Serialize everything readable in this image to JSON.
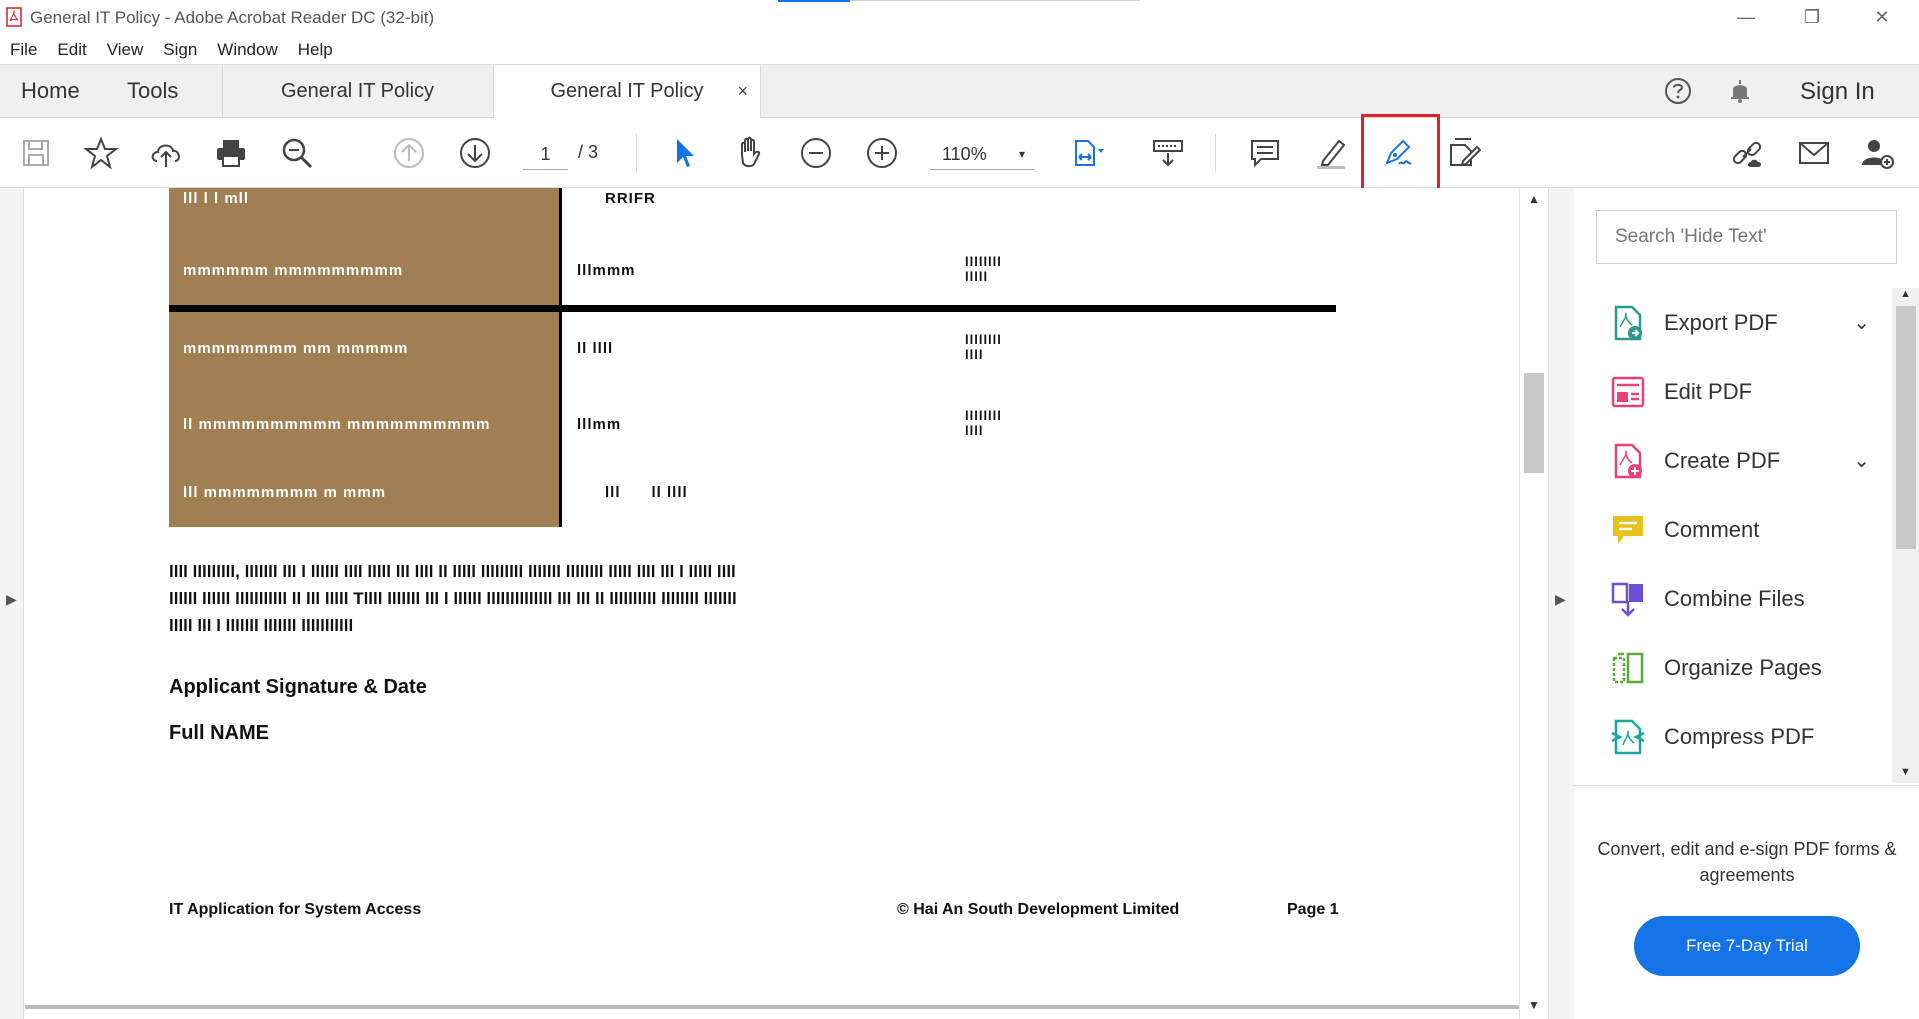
{
  "window": {
    "title": "General IT Policy - Adobe Acrobat Reader DC (32-bit)",
    "minimize": "—",
    "restore": "❐",
    "close": "✕"
  },
  "menu": [
    "File",
    "Edit",
    "View",
    "Sign",
    "Window",
    "Help"
  ],
  "nav": {
    "home": "Home",
    "tools": "Tools",
    "tabs": [
      {
        "label": "General IT Policy"
      },
      {
        "label": "General IT Policy",
        "close": "×"
      }
    ],
    "sign_in": "Sign In"
  },
  "toolbar": {
    "page_current": "1",
    "page_total": "/ 3",
    "zoom": "110%",
    "zoom_caret": "▾"
  },
  "document": {
    "cell_rows_left": [
      "lll l l mll",
      "mmmmmm mmmmmmmmm",
      "mmmmmmmm mm mmmmm",
      "ll mmmmmmmmmm mmmmmmmmmm",
      "lll mmmmmmmm m mmm"
    ],
    "cell_rows_mid": [
      "RRIFR",
      "lllmmm",
      "ll llll",
      "lllmm",
      "lll      ll llll"
    ],
    "cell_rows_right": [
      "llllllll\nlllll",
      "llllllll\nllll",
      "llllllll\nllll"
    ],
    "paragraph_lines": [
      "llll lllllllll,  lllllll lll l llllll llll lllll lll llll ll lllll  lllllllll lllllll llllllll lllll  llll lll l lllll llll",
      "llllll llllll lllllllllll ll lll lllll  Tllll lllllll lll l llllll llllllllllllll lll lll ll llllllllll llllllll lllllll",
      "lllll lll l lllllll lllllll lllllllllll"
    ],
    "signature_line": "Applicant Signature  & Date",
    "name_line": "Full NAME",
    "footer_left": "IT Application for System Access",
    "footer_mid": "© Hai An South Development Limited",
    "footer_right": "Page 1"
  },
  "right_panel": {
    "search_placeholder": "Search 'Hide Text'",
    "tools": [
      {
        "label": "Export PDF",
        "icon": "export-pdf-icon",
        "color": "#2b9a8a",
        "chevron": "⌄"
      },
      {
        "label": "Edit PDF",
        "icon": "edit-pdf-icon",
        "color": "#e8407a"
      },
      {
        "label": "Create PDF",
        "icon": "create-pdf-icon",
        "color": "#e8407a",
        "chevron": "⌄"
      },
      {
        "label": "Comment",
        "icon": "comment-icon",
        "color": "#e8c11a"
      },
      {
        "label": "Combine Files",
        "icon": "combine-files-icon",
        "color": "#6b4fd6"
      },
      {
        "label": "Organize Pages",
        "icon": "organize-pages-icon",
        "color": "#5aaa3a"
      },
      {
        "label": "Compress PDF",
        "icon": "compress-pdf-icon",
        "color": "#1aa7a0"
      }
    ],
    "promo_text": "Convert, edit and e-sign PDF forms & agreements",
    "trial_button": "Free 7-Day Trial"
  },
  "colors": {
    "accent": "#1473e6",
    "highlight_box": "#e0212a",
    "table_fill": "#a07f52"
  }
}
